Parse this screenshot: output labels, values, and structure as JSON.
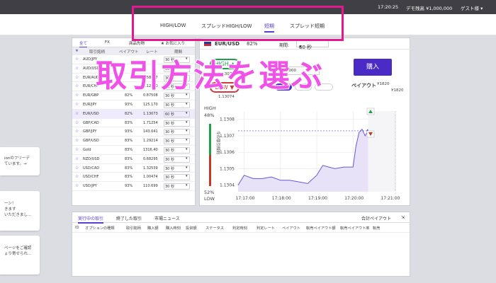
{
  "topbar": {
    "time": "17:20:25",
    "account": "デモ残高 ¥1,000,000",
    "user": "ゲスト様 ▾"
  },
  "nav": {
    "tabs": [
      "HIGH/LOW",
      "スプレッドHIGH/LOW",
      "短期",
      "スプレッド短期"
    ],
    "active": "短期"
  },
  "left_cards": [
    {
      "lines": [
        "ionのフリーデ",
        "ています。→"
      ]
    },
    {
      "lines": [
        "ーン！",
        "きます",
        "いただきまし..."
      ]
    },
    {
      "lines": [
        "ページをご確認",
        "ょり寄せられ..."
      ]
    }
  ],
  "assets": {
    "tabs": [
      "全て",
      "FX",
      "商品先物",
      "★ お気に入り"
    ],
    "headers": [
      "★",
      "取引銘柄",
      "ペイアウト",
      "レート",
      "期間"
    ],
    "rows": [
      {
        "pair": "AUD/JPY",
        "payout": "",
        "rate": "",
        "period": "30 秒"
      },
      {
        "pair": "AUD/USD",
        "payout": "",
        "rate": "",
        "period": "30 秒"
      },
      {
        "pair": "EUR/AUD",
        "payout": "",
        "rate": "1.58827",
        "period": "30 秒"
      },
      {
        "pair": "EUR/CHF",
        "payout": "",
        "rate": "1.12290",
        "period": "30 秒"
      },
      {
        "pair": "EUR/GBP",
        "payout": "82%",
        "rate": "0.87508",
        "period": "30 秒"
      },
      {
        "pair": "EUR/JPY",
        "payout": "93%",
        "rate": "125.170",
        "period": "30 秒"
      },
      {
        "pair": "EUR/USD",
        "payout": "82%",
        "rate": "1.13073",
        "period": "60 秒"
      },
      {
        "pair": "GBP/CAD",
        "payout": "83%",
        "rate": "1.71254",
        "period": "30 秒"
      },
      {
        "pair": "GBP/JPY",
        "payout": "93%",
        "rate": "143.041",
        "period": "30 秒"
      },
      {
        "pair": "GBP/USD",
        "payout": "83%",
        "rate": "1.29214",
        "period": "30 秒"
      },
      {
        "pair": "Gold",
        "payout": "83%",
        "rate": "1316.40",
        "period": "30 秒"
      },
      {
        "pair": "NZD/USD",
        "payout": "83%",
        "rate": "0.68295",
        "period": "30 秒"
      },
      {
        "pair": "USD/CAD",
        "payout": "83%",
        "rate": "1.32539",
        "period": "30 秒"
      },
      {
        "pair": "USD/CHF",
        "payout": "83%",
        "rate": "1.00474",
        "period": "30 秒"
      },
      {
        "pair": "USD/JPY",
        "payout": "93%",
        "rate": "110.699",
        "period": "30 秒"
      }
    ],
    "selected_index": 6
  },
  "trade": {
    "pair": "EUR/USD",
    "payout": "82%",
    "period_label": "期間:",
    "period_value": "60 秒",
    "high_label": "HIGH",
    "low_label": "LOW",
    "high_rate": "1.13072",
    "low_rate": "1.13074",
    "amount_label": "金額",
    "amount_value": "¥ 1,000",
    "chips": [
      "¥1,000",
      "",
      ""
    ],
    "buy_label": "購入",
    "payout_label": "ペイアウト",
    "payout_value": "¥1820",
    "payout_value_bottom": "¥1820"
  },
  "chart_data": {
    "type": "line",
    "x": [
      "17:16:50",
      "17:17:00",
      "17:17:15",
      "17:17:30",
      "17:17:45",
      "17:18:00",
      "17:18:15",
      "17:18:30",
      "17:18:45",
      "17:19:00",
      "17:19:10",
      "17:19:20",
      "17:19:30",
      "17:19:45",
      "17:20:00",
      "17:20:05",
      "17:20:10",
      "17:20:15",
      "17:20:20",
      "17:20:25"
    ],
    "y": [
      1.1304,
      1.13046,
      1.13044,
      1.13044,
      1.13045,
      1.13043,
      1.13043,
      1.13042,
      1.13041,
      1.13046,
      1.13052,
      1.13051,
      1.1305,
      1.13051,
      1.13051,
      1.13064,
      1.13072,
      1.13074,
      1.1307,
      1.13073
    ],
    "yticks": [
      "1.1308",
      "1.1307",
      "1.1306",
      "1.1305",
      "1.1304"
    ],
    "xticks": [
      "17:17:00",
      "17:18:00",
      "17:19:00",
      "17:20:00",
      "17:21:00"
    ],
    "ylim": [
      1.13036,
      1.13085
    ],
    "high_pct": "48%",
    "low_pct": "52%",
    "high_label": "HIGH",
    "low_label": "LOW",
    "side_label": "今の取引傾向",
    "current_rate": 1.13073,
    "line_color": "#6a57d8",
    "fill_color": "#e7e2f8"
  },
  "bottom": {
    "tabs": [
      "実行中の取引",
      "終了した取引",
      "市場ニュース"
    ],
    "total_label": "合計ペイアウト",
    "columns": [
      "ID",
      "オプションの種類",
      "取引銘柄",
      "購入額",
      "購入時刻",
      "投資額",
      "ステータス",
      "判定時刻",
      "判定レート",
      "ペイアウト",
      "転売ペイアウト額",
      "転売ペイアウト率",
      "転売"
    ]
  },
  "overlay": {
    "text": "取引方法を選ぶ",
    "color": "#f052e8"
  }
}
